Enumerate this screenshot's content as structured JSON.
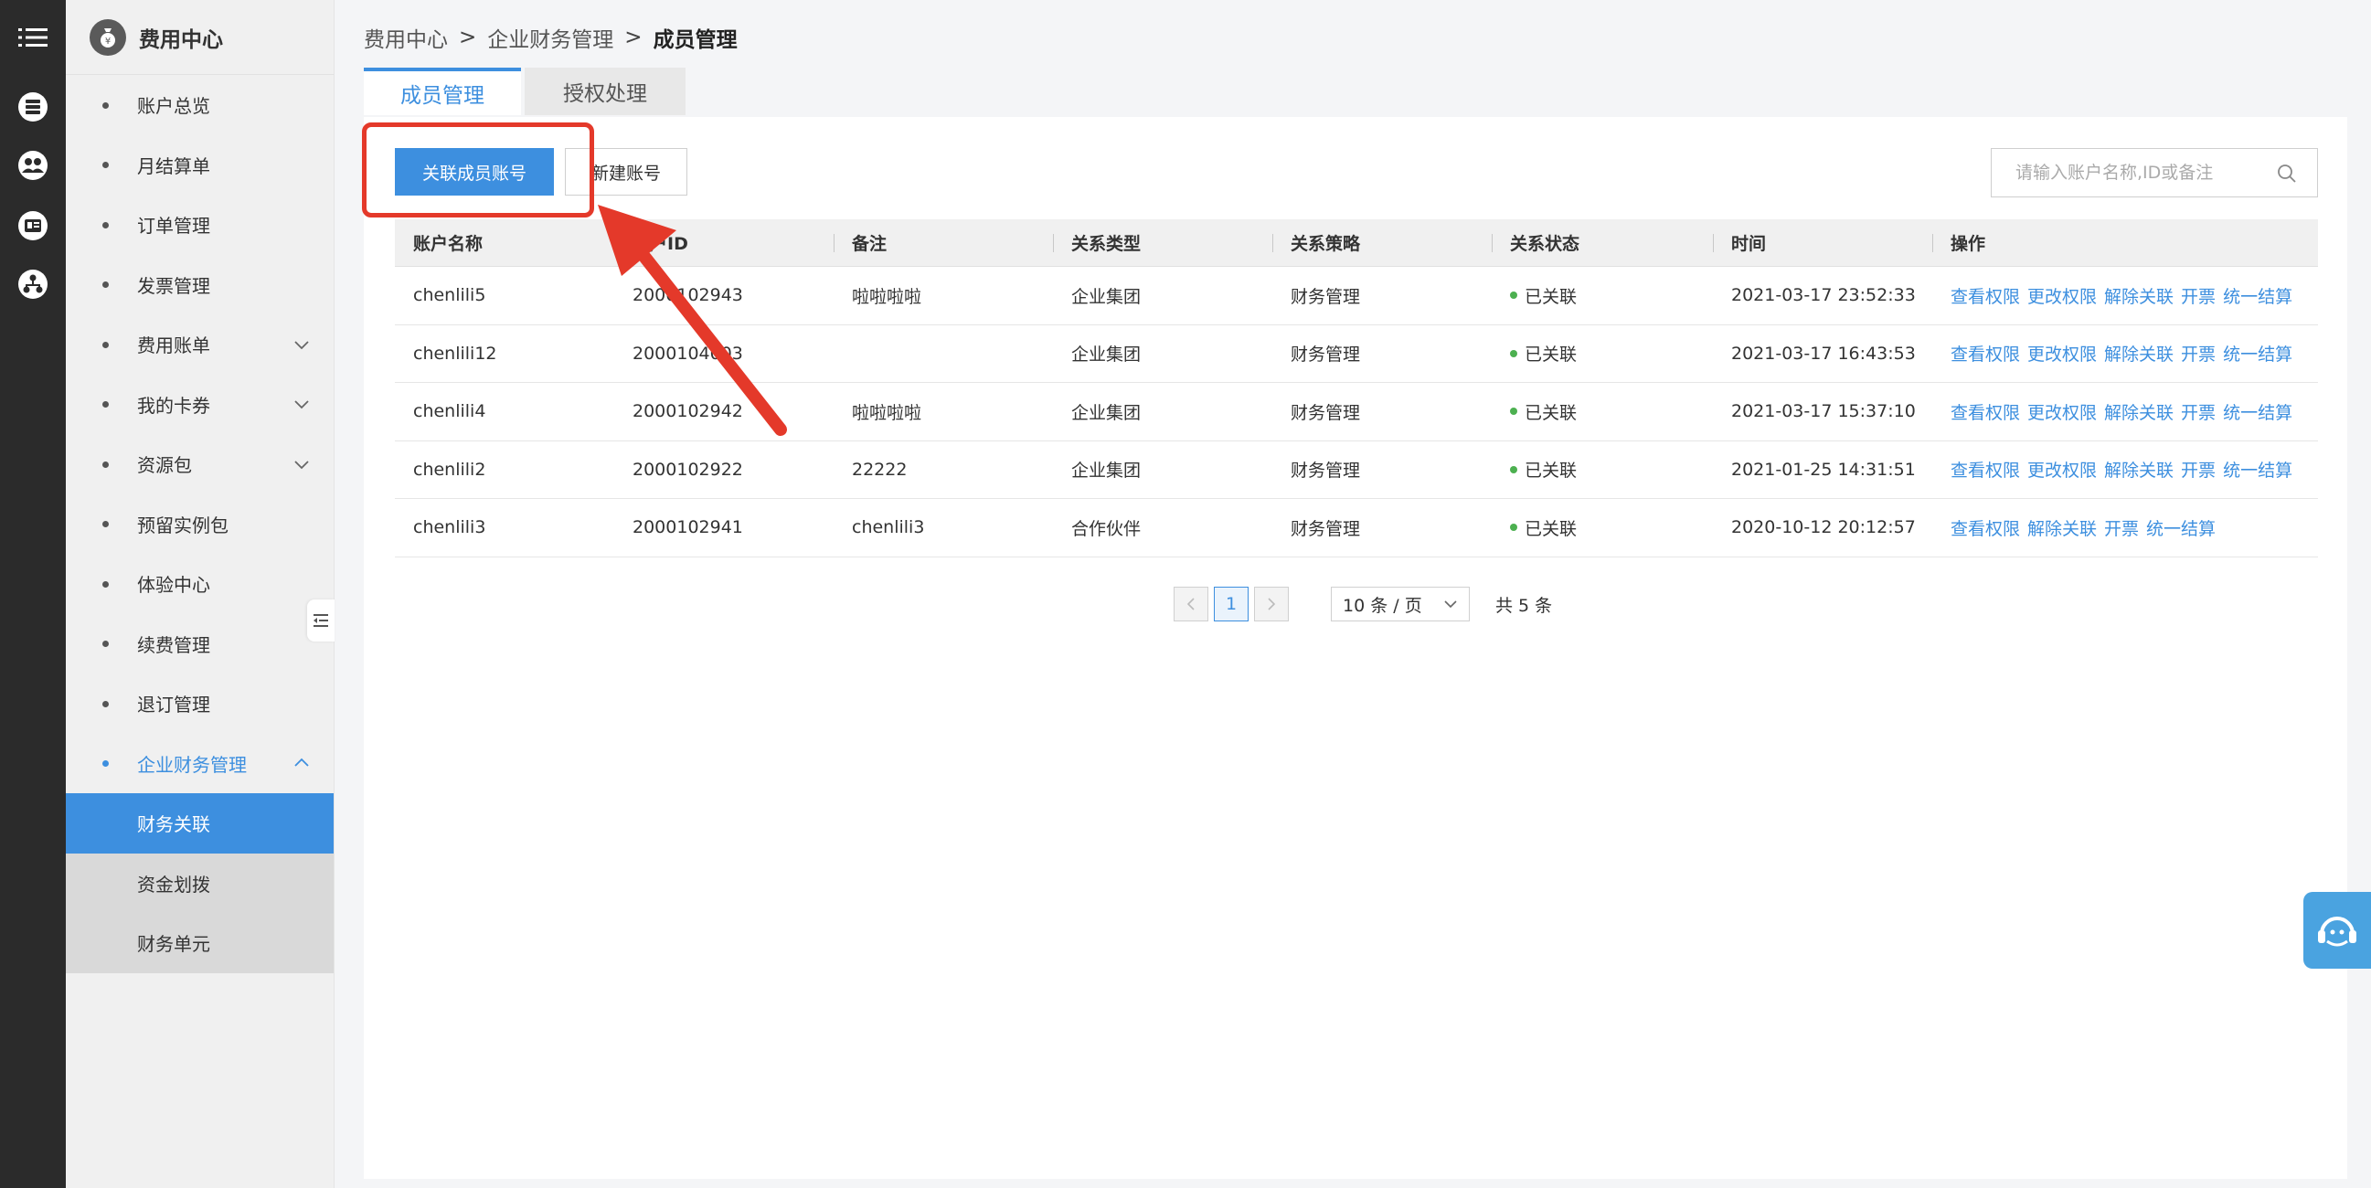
{
  "sidebar": {
    "title": "费用中心",
    "items": [
      {
        "label": "账户总览"
      },
      {
        "label": "月结算单"
      },
      {
        "label": "订单管理"
      },
      {
        "label": "发票管理"
      },
      {
        "label": "费用账单"
      },
      {
        "label": "我的卡券"
      },
      {
        "label": "资源包"
      },
      {
        "label": "预留实例包"
      },
      {
        "label": "体验中心"
      },
      {
        "label": "续费管理"
      },
      {
        "label": "退订管理"
      },
      {
        "label": "企业财务管理"
      }
    ],
    "sub_items": [
      {
        "label": "财务关联"
      },
      {
        "label": "资金划拨"
      },
      {
        "label": "财务单元"
      }
    ]
  },
  "breadcrumb": {
    "level1": "费用中心",
    "level2": "企业财务管理",
    "current": "成员管理",
    "separator": ">"
  },
  "tabs": [
    {
      "label": "成员管理"
    },
    {
      "label": "授权处理"
    }
  ],
  "toolbar": {
    "link_member": "关联成员账号",
    "new_account": "新建账号",
    "search_placeholder": "请输入账户名称,ID或备注"
  },
  "table": {
    "columns": [
      "账户名称",
      "账户ID",
      "备注",
      "关系类型",
      "关系策略",
      "关系状态",
      "时间",
      "操作"
    ],
    "rows": [
      {
        "name": "chenlili5",
        "id": "2000102943",
        "remark": "啦啦啦啦",
        "type": "企业集团",
        "policy": "财务管理",
        "status": "已关联",
        "time": "2021-03-17 23:52:33",
        "ops": [
          "查看权限",
          "更改权限",
          "解除关联",
          "开票",
          "统一结算"
        ]
      },
      {
        "name": "chenlili12",
        "id": "2000104003",
        "remark": "",
        "type": "企业集团",
        "policy": "财务管理",
        "status": "已关联",
        "time": "2021-03-17 16:43:53",
        "ops": [
          "查看权限",
          "更改权限",
          "解除关联",
          "开票",
          "统一结算"
        ]
      },
      {
        "name": "chenlili4",
        "id": "2000102942",
        "remark": "啦啦啦啦",
        "type": "企业集团",
        "policy": "财务管理",
        "status": "已关联",
        "time": "2021-03-17 15:37:10",
        "ops": [
          "查看权限",
          "更改权限",
          "解除关联",
          "开票",
          "统一结算"
        ]
      },
      {
        "name": "chenlili2",
        "id": "2000102922",
        "remark": "22222",
        "type": "企业集团",
        "policy": "财务管理",
        "status": "已关联",
        "time": "2021-01-25 14:31:51",
        "ops": [
          "查看权限",
          "更改权限",
          "解除关联",
          "开票",
          "统一结算"
        ]
      },
      {
        "name": "chenlili3",
        "id": "2000102941",
        "remark": "chenlili3",
        "type": "合作伙伴",
        "policy": "财务管理",
        "status": "已关联",
        "time": "2020-10-12 20:12:57",
        "ops": [
          "查看权限",
          "解除关联",
          "开票",
          "统一结算"
        ]
      }
    ]
  },
  "pagination": {
    "prev": "<",
    "current_page": "1",
    "next": ">",
    "page_size": "10 条 / 页",
    "total": "共 5 条"
  },
  "colors": {
    "accent": "#3d8fdf",
    "rail": "#2b2b2b",
    "status_green": "#4cb050",
    "annotation_red": "#e4392a"
  },
  "icons": {
    "rail": [
      "menu-icon",
      "database-icon",
      "group-icon",
      "id-card-icon",
      "org-chart-icon"
    ],
    "logo": "money-bag-icon",
    "search": "search-icon",
    "collapse": "collapse-sidebar-icon",
    "float": "chat-robot-icon"
  }
}
